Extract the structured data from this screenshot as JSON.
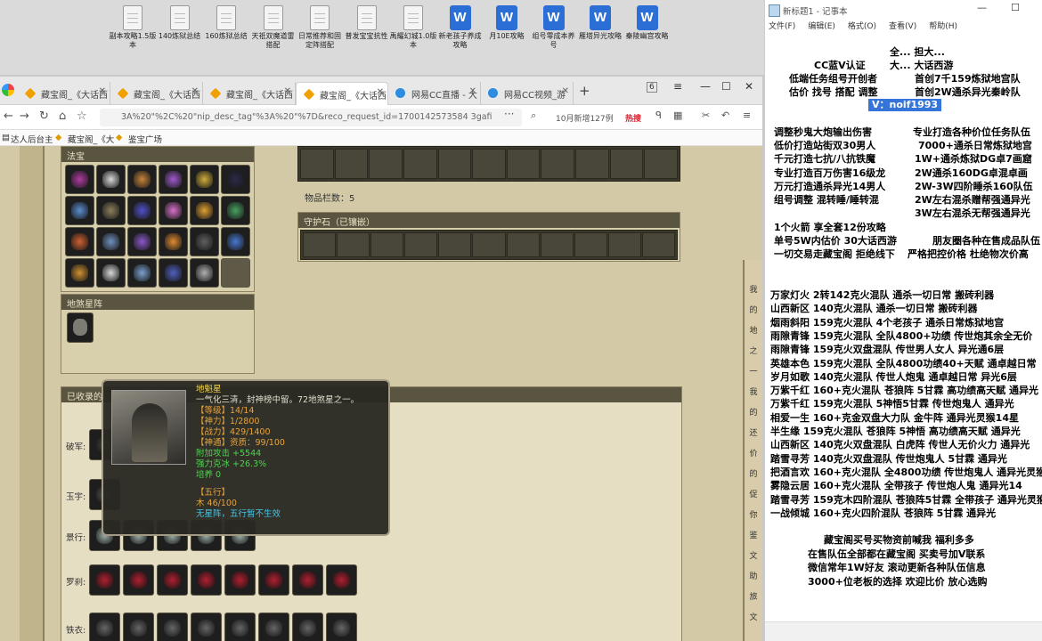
{
  "desktop_icons": [
    {
      "label": "副本攻略1.5版本",
      "type": "file"
    },
    {
      "label": "140炼狱总结",
      "type": "file"
    },
    {
      "label": "160炼狱总结",
      "type": "file"
    },
    {
      "label": "天祇双魔道雷搭配",
      "type": "file"
    },
    {
      "label": "日常推荐和固定阵搭配",
      "type": "file"
    },
    {
      "label": "普发宝宝抗性",
      "type": "file"
    },
    {
      "label": "禹耀幻城1.0版本",
      "type": "file"
    },
    {
      "label": "新老孩子养成攻略",
      "type": "word"
    },
    {
      "label": "月10E攻略",
      "type": "word"
    },
    {
      "label": "组号零成本养号",
      "type": "word"
    },
    {
      "label": "雁塔异光攻略",
      "type": "word"
    },
    {
      "label": "秦陵幽宫攻略",
      "type": "word"
    }
  ],
  "browser": {
    "tabs": [
      {
        "label": "藏宝阁_《大话西",
        "icon": "cbg"
      },
      {
        "label": "藏宝阁_《大话西",
        "icon": "cbg"
      },
      {
        "label": "藏宝阁_《大话西",
        "icon": "cbg"
      },
      {
        "label": "藏宝阁_《大话西",
        "icon": "cbg",
        "active": true
      },
      {
        "label": "网易CC直播 - 大",
        "icon": "cc"
      },
      {
        "label": "网易CC视频_游",
        "icon": "cc"
      }
    ],
    "tab_count": "6",
    "url": "3A%20\"%2C%20\"nip_desc_tag\"%3A%20\"%7D&reco_request_id=1700142573584 3gafi",
    "search_text": "10月新增127例",
    "search_badge": "热搜",
    "bookmarks": [
      "达人后台主",
      "藏宝阁_《大",
      "鉴宝广场"
    ]
  },
  "game": {
    "section_fate": "法宝",
    "item_count_label": "物品栏数：5",
    "guard_stone_label": "守护石（已镶嵌）",
    "star_section": "地煞星阵",
    "collected_section": "已收录的",
    "tooltip": {
      "name": "地魁星",
      "desc": "一气化三清，封神榜中留。72地煞星之一。",
      "level": "【等级】14/14",
      "divine": "【神力】1/2800",
      "combat": "【战力】429/1400",
      "qualification": "【神通】资质：99/100",
      "bonus1": "附加攻击 +5544",
      "bonus2": "强力克冰 +26.3%",
      "cultivate": "培养 0",
      "five_title": "【五行】",
      "five_value": "木 46/100",
      "five_note": "无星阵，五行暂不生效"
    },
    "rows": [
      {
        "label": "破军:",
        "count": 1
      },
      {
        "label": "玉宇:",
        "count": 1
      },
      {
        "label": "景行:",
        "count": 5
      },
      {
        "label": "罗刹:",
        "count": 8
      },
      {
        "label": "铁衣:",
        "count": 8
      }
    ],
    "side_text": [
      "我",
      "的",
      "地",
      "之",
      "一",
      "我",
      "的",
      "还",
      "价",
      "的",
      "促",
      "你",
      "鉴",
      "文",
      "助",
      "旅",
      "文"
    ]
  },
  "notepad": {
    "title": "新标题1 - 记事本",
    "menu": [
      "文件(F)",
      "编辑(E)",
      "格式(O)",
      "查看(V)",
      "帮助(H)"
    ],
    "header": [
      {
        "left": "",
        "right": "全... 担大..."
      },
      {
        "left": "CC蓝V认证",
        "right": "大... 大话西游"
      },
      {
        "left": "低端任务组号开创者",
        "right": "首创7千159炼狱地宫队"
      },
      {
        "left": "估价 找号 搭配 调整",
        "right": "首创2W通杀异光秦岭队"
      }
    ],
    "contact": "V：noif1993",
    "services": [
      [
        "调整秒鬼大炮输出伤害",
        "专业打造各种价位任务队伍"
      ],
      [
        "低价打造站街双30男人",
        "7000+通杀日常炼狱地宫"
      ],
      [
        "千元打造七抗/八抗铁魔",
        "1W+通杀炼狱DG卓7画窟"
      ],
      [
        "专业打造百万伤害16级龙",
        "2W通杀160DG卓混卓画"
      ],
      [
        "万元打造通杀异光14男人",
        "2W-3W四阶睡杀160队伍"
      ],
      [
        "组号调整 混转睡/睡转混",
        "2W左右混杀赠帮强通异光"
      ],
      [
        "",
        "3W左右混杀无帮强通异光"
      ]
    ],
    "line_a": "1个火箭 享全套12份攻略",
    "line_b1": "单号5W内估价 30大话西游",
    "line_b2": "朋友圈各种在售成品队伍",
    "line_c1": "一切交易走藏宝阁 拒绝线下",
    "line_c2": "严格把控价格 杜绝物次价高",
    "teams": [
      "万家灯火 2转142克火混队 通杀一切日常 搬砖利器",
      "山西新区 140克火混队 通杀一切日常 搬砖利器",
      "烟雨斜阳 159克火混队 4个老孩子 通杀日常炼狱地宫",
      "雨隙青锋 159克火混队 全队4800+功绩 传世炮其余全无价",
      "雨隙青锋 159克火双盘混队 传世男人女人 异光通6层",
      "英雄本色 159克火混队 全队4800功绩40+天赋 通卓越日常",
      "岁月如歌 140克火混队 传世人炮鬼 通卓越日常 异光6层",
      "万紫千红 160+克火混队 苍狼阵 5甘霖 高功绩高天赋 通异光",
      "万紫千红 159克火混队 5神悟5甘霖 传世炮鬼人 通异光",
      "相爱一生 160+克金双盘大力队 金牛阵 通异光灵猴14星",
      "半生缘 159克火混队 苍狼阵 5神悟 高功绩高天赋 通异光",
      "山西新区 140克火双盘混队 白虎阵 传世人无价火力 通异光",
      "踏雪寻芳 140克火双盘混队 传世炮鬼人 5甘霖 通异光",
      "把酒言欢 160+克火混队 全4800功绩 传世炮鬼人 通异光灵猴",
      "雾隐云居 160+克火混队 全带孩子 传世炮人鬼 通异光14",
      "踏雪寻芳 159克木四阶混队 苍狼阵5甘霖 全带孩子 通异光灵猴",
      "一战倾城 160+克火四阶混队 苍狼阵 5甘霖 通异光"
    ],
    "footer": [
      "藏宝阁买号买物资前喊我 福利多多",
      "在售队伍全部都在藏宝阁 买卖号加V联系",
      "微信常年1W好友 滚动更新各种队伍信息",
      "3000+位老板的选择 欢迎比价 放心选购"
    ]
  },
  "colors": {
    "tooltip_name": "#f2d54a",
    "tooltip_stat": "#e8a33c",
    "tooltip_bonus": "#4fd34f",
    "tooltip_cyan": "#42c7e8",
    "selection": "#3574d8"
  }
}
